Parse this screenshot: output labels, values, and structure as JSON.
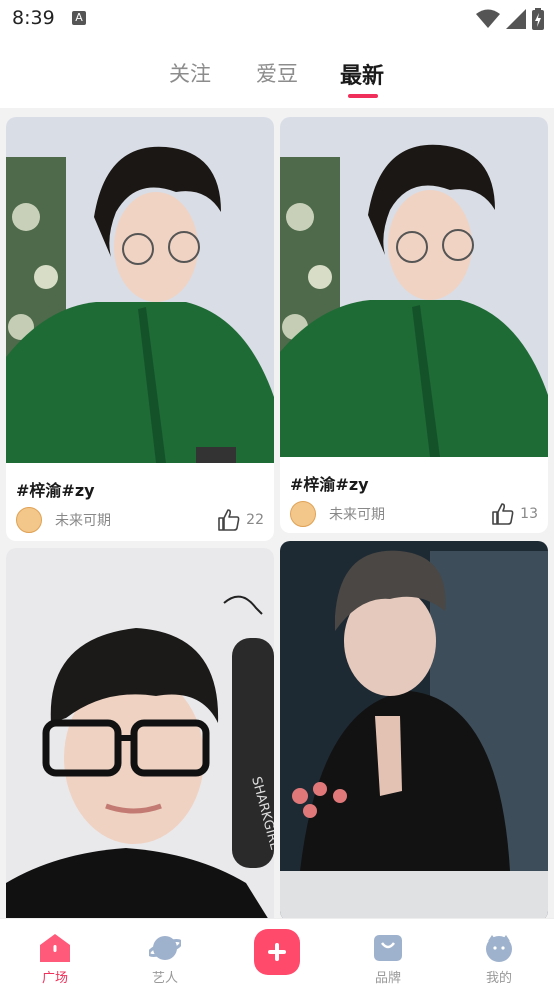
{
  "status_bar": {
    "time": "8:39",
    "notification_letter": "A"
  },
  "tabs": [
    {
      "label": "关注",
      "active": false
    },
    {
      "label": "爱豆",
      "active": false
    },
    {
      "label": "最新",
      "active": true
    }
  ],
  "feed": {
    "cards": [
      {
        "title": "#梓渝#zy",
        "author": "未来可期",
        "likes": "22"
      },
      {
        "title": "#梓渝#zy",
        "author": "未来可期",
        "likes": "13"
      },
      {
        "title": "",
        "author": "",
        "likes": ""
      },
      {
        "title": "",
        "author": "",
        "likes": ""
      }
    ],
    "photo_sticker_text": "SHARKGIRL"
  },
  "bottom_nav": [
    {
      "label": "广场",
      "icon": "home-icon",
      "active": true
    },
    {
      "label": "艺人",
      "icon": "planet-icon",
      "active": false
    },
    {
      "label": "",
      "icon": "plus-icon",
      "active": false
    },
    {
      "label": "品牌",
      "icon": "bag-icon",
      "active": false
    },
    {
      "label": "我的",
      "icon": "profile-face-icon",
      "active": false
    }
  ],
  "colors": {
    "accent": "#f0305a",
    "add_button": "#ff4a6b",
    "feed_bg": "#f2f2f2"
  }
}
